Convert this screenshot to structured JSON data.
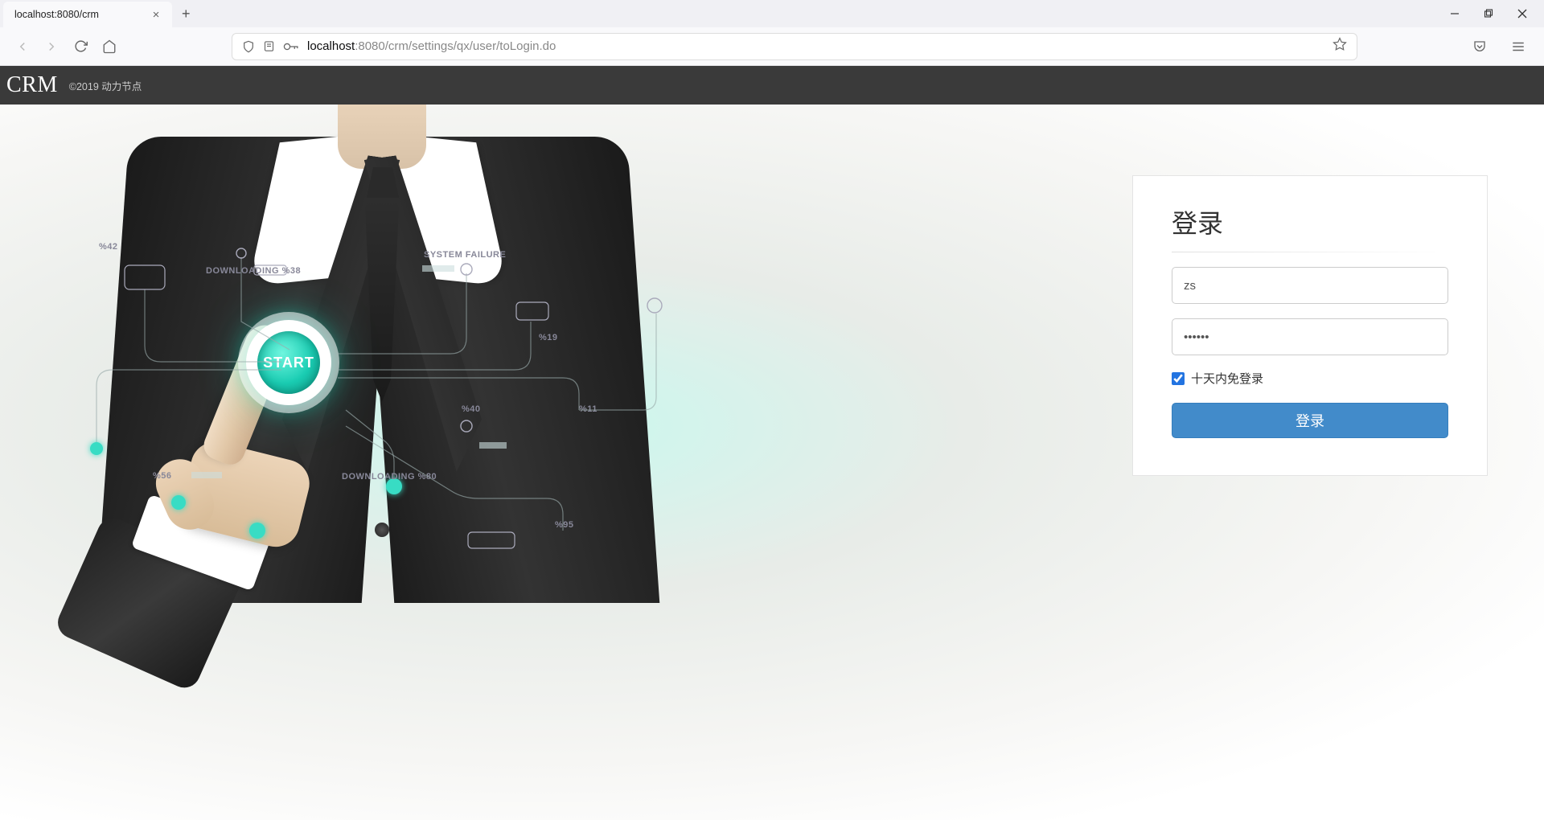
{
  "window": {
    "tab_title": "localhost:8080/crm"
  },
  "address_bar": {
    "host": "localhost",
    "port_path": ":8080/crm/settings/qx/user/toLogin.do"
  },
  "header": {
    "brand": "CRM",
    "copyright": "©2019 动力节点"
  },
  "hero": {
    "start_label": "START",
    "hud_labels": {
      "pct56": "%56",
      "pct42": "%42",
      "pct40": "%40",
      "pct19": "%19",
      "pct11": "%11",
      "pct95": "%95",
      "downloading": "DOWNLOADING  %80",
      "system": "SYSTEM FAILURE",
      "loading": "DOWNLOADING %38"
    }
  },
  "login": {
    "title": "登录",
    "username_value": "zs",
    "password_value": "••••••",
    "remember_label": "十天内免登录",
    "remember_checked": true,
    "button_label": "登录"
  }
}
